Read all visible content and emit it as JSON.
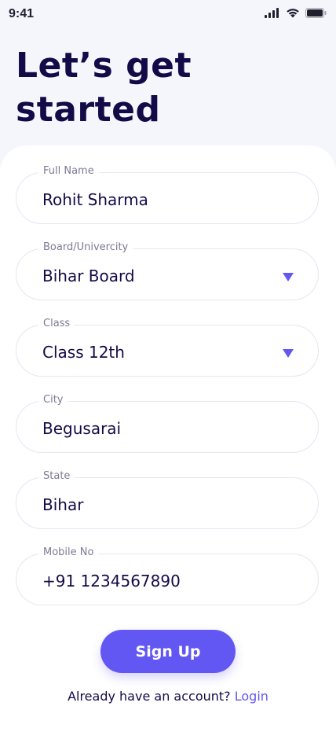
{
  "status_bar": {
    "time": "9:41",
    "icons": [
      "cellular-signal-icon",
      "wifi-icon",
      "battery-icon"
    ]
  },
  "header": {
    "title_line1": "Let’s get",
    "title_line2": "started"
  },
  "form": {
    "full_name": {
      "label": "Full Name",
      "value": "Rohit Sharma"
    },
    "board": {
      "label": "Board/Univercity",
      "value": "Bihar Board",
      "icon": "dropdown-caret-icon"
    },
    "class": {
      "label": "Class",
      "value": "Class 12th",
      "icon": "dropdown-caret-icon"
    },
    "city": {
      "label": "City",
      "value": "Begusarai"
    },
    "state": {
      "label": "State",
      "value": "Bihar"
    },
    "mobile": {
      "label": "Mobile No",
      "value": "+91 1234567890"
    }
  },
  "actions": {
    "signup_label": "Sign Up",
    "login_prompt": "Already have an account?",
    "login_label": "Login"
  },
  "colors": {
    "accent": "#6357f3",
    "heading": "#140a47",
    "background": "#f5f5fc",
    "card": "#ffffff",
    "field_border": "#e6e6f2",
    "label": "#7c7a96"
  }
}
